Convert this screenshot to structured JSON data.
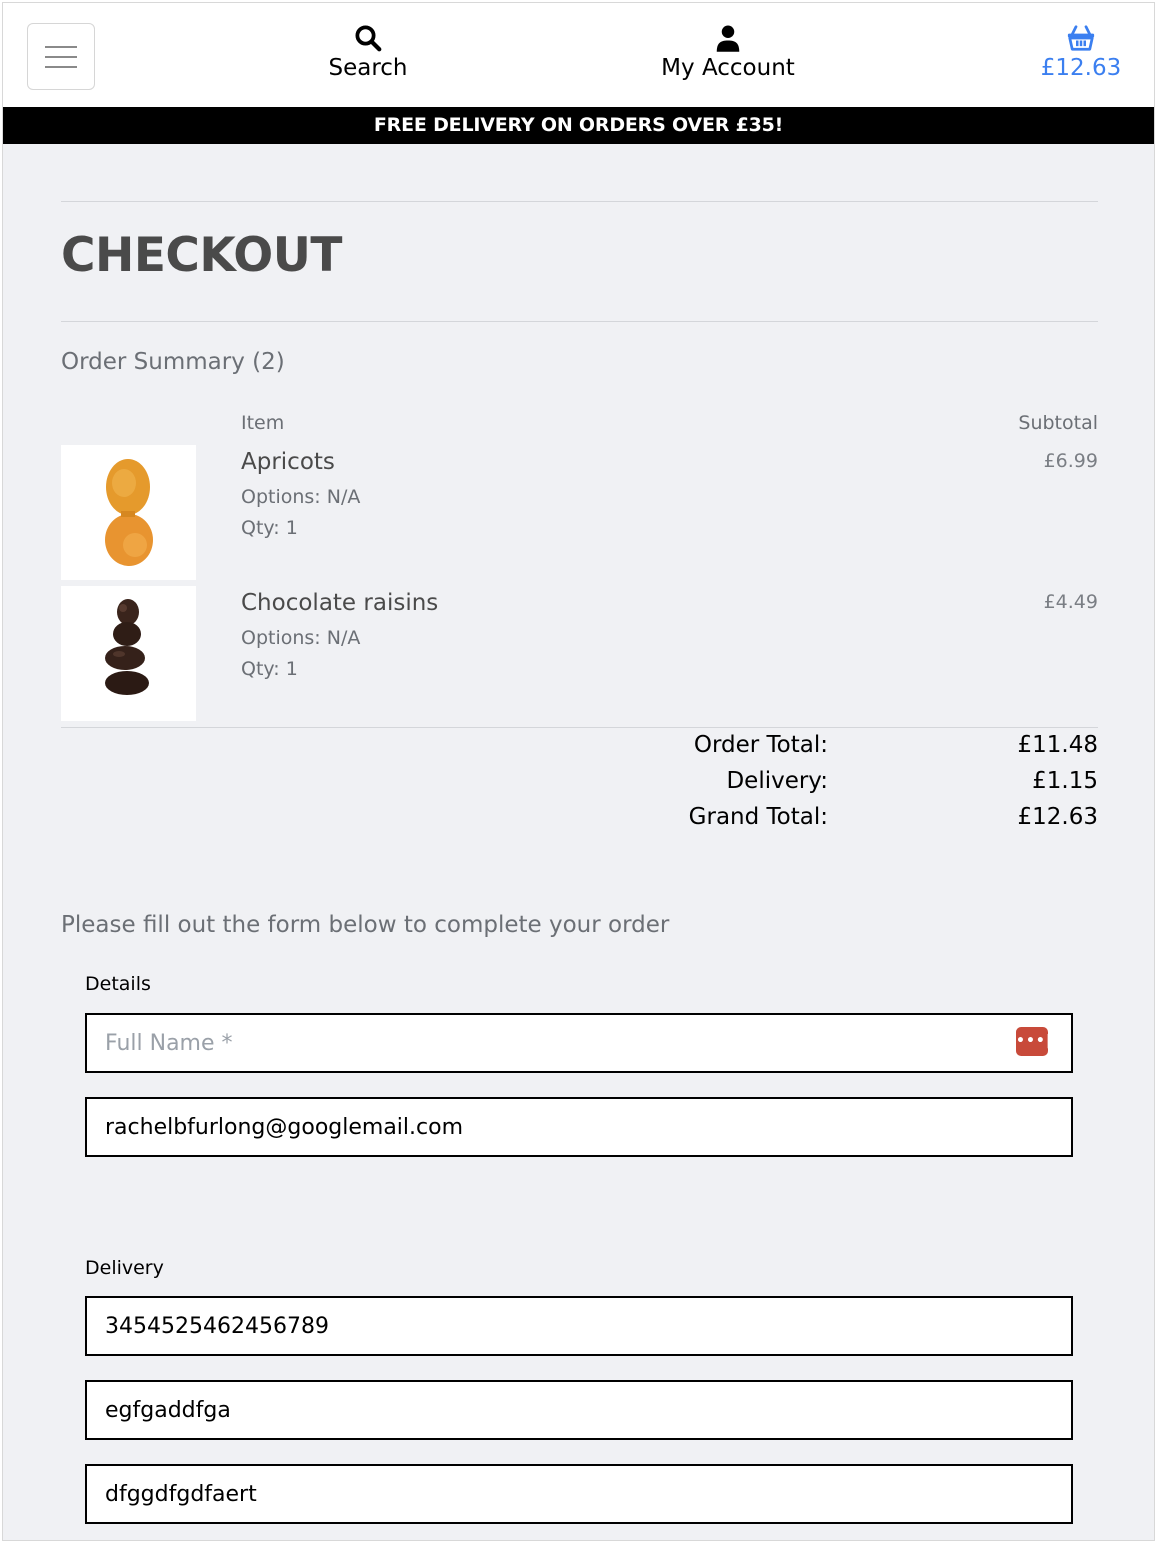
{
  "header": {
    "search_label": "Search",
    "account_label": "My Account",
    "basket_total": "£12.63"
  },
  "promo": {
    "text": "FREE DELIVERY ON ORDERS OVER £35!"
  },
  "page": {
    "title": "CHECKOUT"
  },
  "summary": {
    "title": "Order Summary (2)",
    "col_item": "Item",
    "col_subtotal": "Subtotal",
    "items": [
      {
        "name": "Apricots",
        "options": "Options: N/A",
        "qty": "Qty: 1",
        "price": "£6.99"
      },
      {
        "name": "Chocolate raisins",
        "options": "Options: N/A",
        "qty": "Qty: 1",
        "price": "£4.49"
      }
    ],
    "totals": {
      "order_total_label": "Order Total:",
      "order_total": "£11.48",
      "delivery_label": "Delivery:",
      "delivery": "£1.15",
      "grand_total_label": "Grand Total:",
      "grand_total": "£12.63"
    }
  },
  "form": {
    "intro": "Please fill out the form below to complete your order",
    "details_label": "Details",
    "full_name": {
      "placeholder": "Full Name *",
      "value": ""
    },
    "email": {
      "value": "rachelbfurlong@googlemail.com"
    },
    "delivery_label": "Delivery",
    "phone": {
      "value": "3454525462456789"
    },
    "address_line_1": {
      "value": "egfgaddfga"
    },
    "address_line_2": {
      "value": "dfggdfgdfaert"
    }
  },
  "colors": {
    "accent": "#3b7ff0",
    "promo_bg": "#000000",
    "page_bg": "#f0f1f4",
    "password_badge": "#c84a3a"
  }
}
